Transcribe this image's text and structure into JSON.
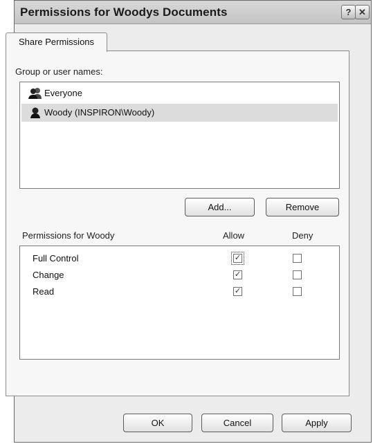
{
  "window": {
    "title": "Permissions for Woodys Documents",
    "help_glyph": "?",
    "close_glyph": "✕"
  },
  "tabs": [
    {
      "label": "Share Permissions"
    }
  ],
  "group_list": {
    "label": "Group or user names:",
    "items": [
      {
        "name": "Everyone",
        "icon": "group-icon",
        "selected": false
      },
      {
        "name": "Woody (INSPIRON\\Woody)",
        "icon": "user-icon",
        "selected": true
      }
    ],
    "add_label": "Add...",
    "remove_label": "Remove"
  },
  "permissions": {
    "title": "Permissions for Woody",
    "allow_header": "Allow",
    "deny_header": "Deny",
    "rows": [
      {
        "name": "Full Control",
        "allow": true,
        "deny": false
      },
      {
        "name": "Change",
        "allow": true,
        "deny": false
      },
      {
        "name": "Read",
        "allow": true,
        "deny": false
      }
    ]
  },
  "footer": {
    "ok_label": "OK",
    "cancel_label": "Cancel",
    "apply_label": "Apply"
  }
}
